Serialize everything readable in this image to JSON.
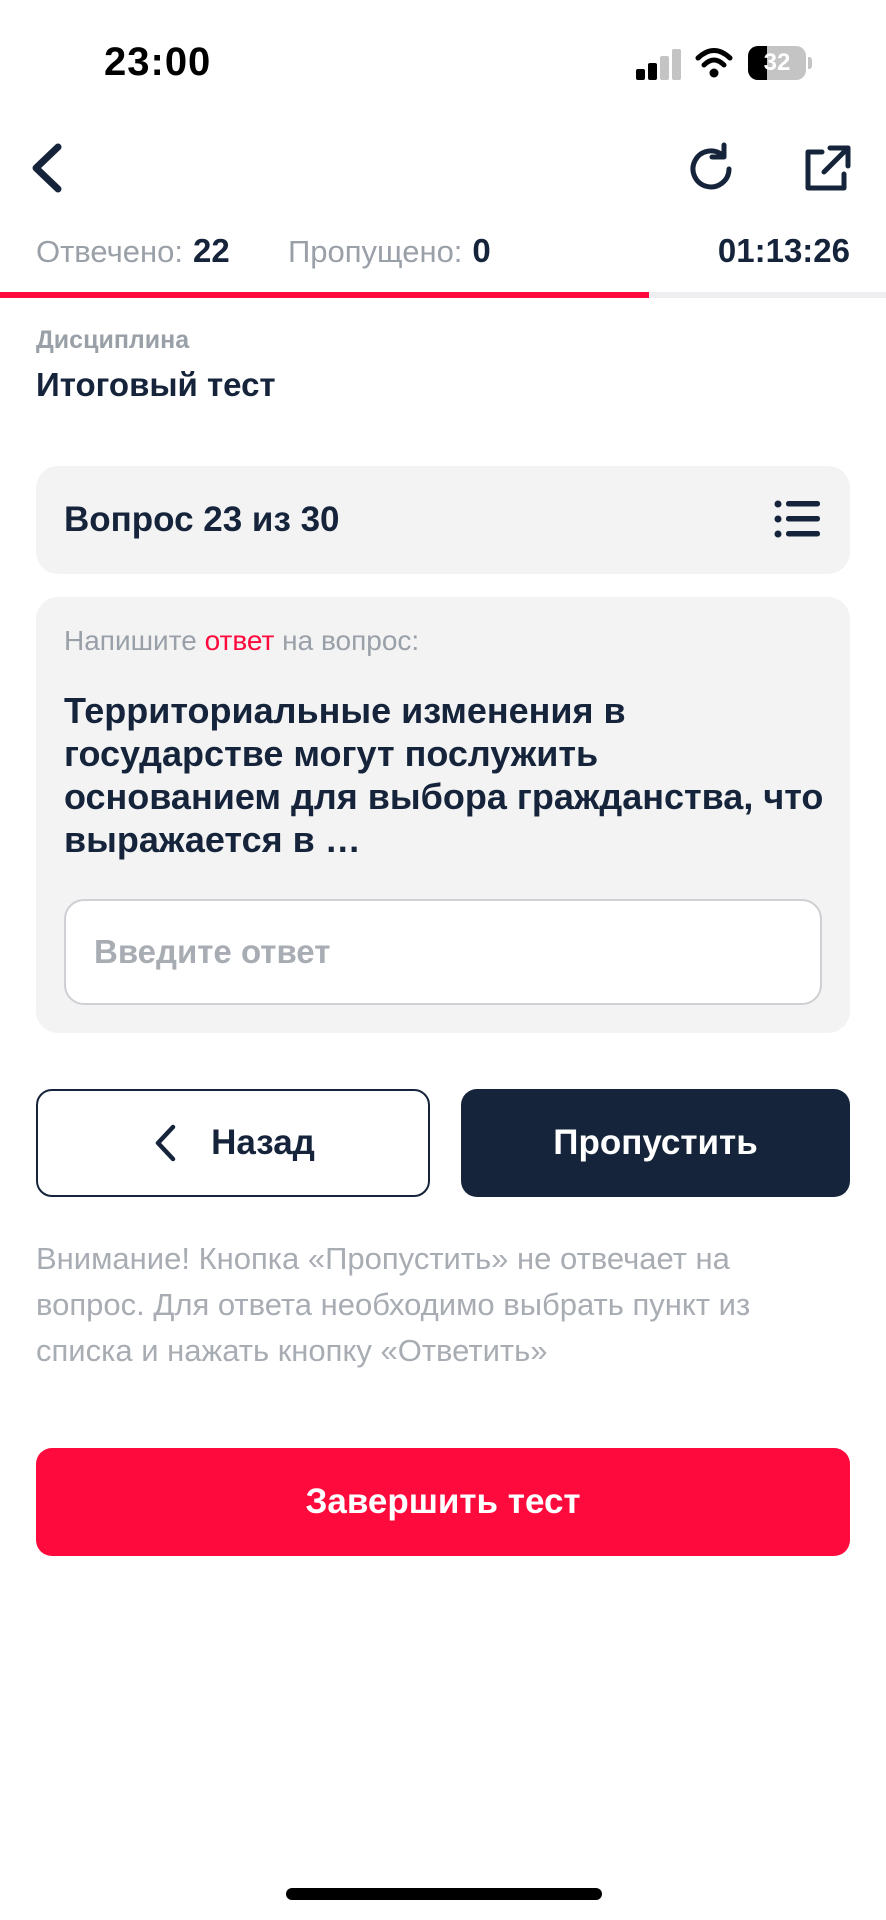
{
  "status_bar": {
    "time": "23:00",
    "battery_level": "32",
    "battery_fraction": 0.32,
    "signal_bars": 2,
    "signal_bars_total": 4
  },
  "nav": {
    "back_icon": "chevron-left-icon",
    "refresh_icon": "refresh-icon",
    "share_icon": "external-link-icon"
  },
  "stats": {
    "answered_label": "Отвечено:",
    "answered_value": "22",
    "skipped_label": "Пропущено:",
    "skipped_value": "0",
    "timer": "01:13:26"
  },
  "progress": {
    "fraction": 0.733
  },
  "discipline": {
    "label": "Дисциплина",
    "value": "Итоговый тест"
  },
  "question": {
    "counter": "Вопрос 23 из 30",
    "list_icon": "list-icon",
    "hint_before": "Напишите ",
    "hint_accent": "ответ",
    "hint_after": " на вопрос:",
    "text": "Территориальные изменения в государстве могут послужить основанием для выбора гражданства, что выражается в …",
    "answer_placeholder": "Введите ответ",
    "answer_value": ""
  },
  "buttons": {
    "back_label": "Назад",
    "skip_label": "Пропустить",
    "finish_label": "Завершить тест"
  },
  "notice": "Внимание! Кнопка «Пропустить» не отвечает на вопрос. Для ответа необходимо выбрать пункт из списка и нажать кнопку «Ответить»",
  "colors": {
    "accent": "#ff0a3c",
    "primary": "#15243a",
    "muted": "#9aa0a8",
    "card": "#f3f3f4"
  }
}
